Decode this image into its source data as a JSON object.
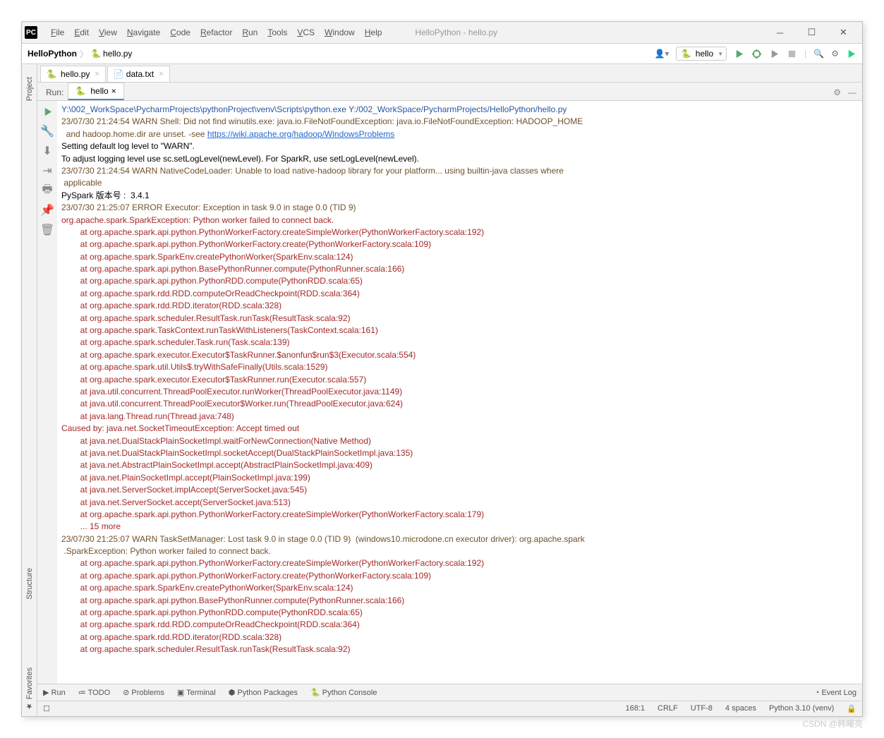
{
  "window": {
    "app_badge": "PC",
    "title": "HelloPython - hello.py"
  },
  "menu": [
    "File",
    "Edit",
    "View",
    "Navigate",
    "Code",
    "Refactor",
    "Run",
    "Tools",
    "VCS",
    "Window",
    "Help"
  ],
  "breadcrumb": {
    "project": "HelloPython",
    "file": "hello.py"
  },
  "run_config": "hello",
  "editor_tabs": [
    {
      "icon": "python",
      "label": "hello.py"
    },
    {
      "icon": "text",
      "label": "data.txt"
    }
  ],
  "run": {
    "label": "Run:",
    "tab": "hello"
  },
  "left_tabs": [
    "Project",
    "Structure",
    "Favorites"
  ],
  "console_lines": [
    {
      "c": "blue",
      "t": "Y:\\002_WorkSpace\\PycharmProjects\\pythonProject\\venv\\Scripts\\python.exe Y:/002_WorkSpace/PycharmProjects/HelloPython/hello.py"
    },
    {
      "c": "brown",
      "t": "23/07/30 21:24:54 WARN Shell: Did not find winutils.exe: java.io.FileNotFoundException: java.io.FileNotFoundException: HADOOP_HOME"
    },
    {
      "c": "brown",
      "t": "  and hadoop.home.dir are unset. -see ",
      "link": "https://wiki.apache.org/hadoop/WindowsProblems"
    },
    {
      "c": "black",
      "t": "Setting default log level to \"WARN\"."
    },
    {
      "c": "black",
      "t": "To adjust logging level use sc.setLogLevel(newLevel). For SparkR, use setLogLevel(newLevel)."
    },
    {
      "c": "brown",
      "t": "23/07/30 21:24:54 WARN NativeCodeLoader: Unable to load native-hadoop library for your platform... using builtin-java classes where"
    },
    {
      "c": "brown",
      "t": " applicable"
    },
    {
      "c": "black",
      "t": "PySpark 版本号 :  3.4.1"
    },
    {
      "c": "brown",
      "t": "23/07/30 21:25:07 ERROR Executor: Exception in task 9.0 in stage 0.0 (TID 9)"
    },
    {
      "c": "red",
      "t": "org.apache.spark.SparkException: Python worker failed to connect back."
    },
    {
      "c": "red",
      "t": "        at org.apache.spark.api.python.PythonWorkerFactory.createSimpleWorker(PythonWorkerFactory.scala:192)"
    },
    {
      "c": "red",
      "t": "        at org.apache.spark.api.python.PythonWorkerFactory.create(PythonWorkerFactory.scala:109)"
    },
    {
      "c": "red",
      "t": "        at org.apache.spark.SparkEnv.createPythonWorker(SparkEnv.scala:124)"
    },
    {
      "c": "red",
      "t": "        at org.apache.spark.api.python.BasePythonRunner.compute(PythonRunner.scala:166)"
    },
    {
      "c": "red",
      "t": "        at org.apache.spark.api.python.PythonRDD.compute(PythonRDD.scala:65)"
    },
    {
      "c": "red",
      "t": "        at org.apache.spark.rdd.RDD.computeOrReadCheckpoint(RDD.scala:364)"
    },
    {
      "c": "red",
      "t": "        at org.apache.spark.rdd.RDD.iterator(RDD.scala:328)"
    },
    {
      "c": "red",
      "t": "        at org.apache.spark.scheduler.ResultTask.runTask(ResultTask.scala:92)"
    },
    {
      "c": "red",
      "t": "        at org.apache.spark.TaskContext.runTaskWithListeners(TaskContext.scala:161)"
    },
    {
      "c": "red",
      "t": "        at org.apache.spark.scheduler.Task.run(Task.scala:139)"
    },
    {
      "c": "red",
      "t": "        at org.apache.spark.executor.Executor$TaskRunner.$anonfun$run$3(Executor.scala:554)"
    },
    {
      "c": "red",
      "t": "        at org.apache.spark.util.Utils$.tryWithSafeFinally(Utils.scala:1529)"
    },
    {
      "c": "red",
      "t": "        at org.apache.spark.executor.Executor$TaskRunner.run(Executor.scala:557)"
    },
    {
      "c": "red",
      "t": "        at java.util.concurrent.ThreadPoolExecutor.runWorker(ThreadPoolExecutor.java:1149)"
    },
    {
      "c": "red",
      "t": "        at java.util.concurrent.ThreadPoolExecutor$Worker.run(ThreadPoolExecutor.java:624)"
    },
    {
      "c": "red",
      "t": "        at java.lang.Thread.run(Thread.java:748)"
    },
    {
      "c": "red",
      "t": "Caused by: java.net.SocketTimeoutException: Accept timed out"
    },
    {
      "c": "red",
      "t": "        at java.net.DualStackPlainSocketImpl.waitForNewConnection(Native Method)"
    },
    {
      "c": "red",
      "t": "        at java.net.DualStackPlainSocketImpl.socketAccept(DualStackPlainSocketImpl.java:135)"
    },
    {
      "c": "red",
      "t": "        at java.net.AbstractPlainSocketImpl.accept(AbstractPlainSocketImpl.java:409)"
    },
    {
      "c": "red",
      "t": "        at java.net.PlainSocketImpl.accept(PlainSocketImpl.java:199)"
    },
    {
      "c": "red",
      "t": "        at java.net.ServerSocket.implAccept(ServerSocket.java:545)"
    },
    {
      "c": "red",
      "t": "        at java.net.ServerSocket.accept(ServerSocket.java:513)"
    },
    {
      "c": "red",
      "t": "        at org.apache.spark.api.python.PythonWorkerFactory.createSimpleWorker(PythonWorkerFactory.scala:179)"
    },
    {
      "c": "red",
      "t": "        ... 15 more"
    },
    {
      "c": "brown",
      "t": "23/07/30 21:25:07 WARN TaskSetManager: Lost task 9.0 in stage 0.0 (TID 9)  (windows10.microdone.cn executor driver): org.apache.spark"
    },
    {
      "c": "brown",
      "t": " .SparkException: Python worker failed to connect back."
    },
    {
      "c": "red",
      "t": "        at org.apache.spark.api.python.PythonWorkerFactory.createSimpleWorker(PythonWorkerFactory.scala:192)"
    },
    {
      "c": "red",
      "t": "        at org.apache.spark.api.python.PythonWorkerFactory.create(PythonWorkerFactory.scala:109)"
    },
    {
      "c": "red",
      "t": "        at org.apache.spark.SparkEnv.createPythonWorker(SparkEnv.scala:124)"
    },
    {
      "c": "red",
      "t": "        at org.apache.spark.api.python.BasePythonRunner.compute(PythonRunner.scala:166)"
    },
    {
      "c": "red",
      "t": "        at org.apache.spark.api.python.PythonRDD.compute(PythonRDD.scala:65)"
    },
    {
      "c": "red",
      "t": "        at org.apache.spark.rdd.RDD.computeOrReadCheckpoint(RDD.scala:364)"
    },
    {
      "c": "red",
      "t": "        at org.apache.spark.rdd.RDD.iterator(RDD.scala:328)"
    },
    {
      "c": "red",
      "t": "        at org.apache.spark.scheduler.ResultTask.runTask(ResultTask.scala:92)"
    }
  ],
  "bottom_tools": [
    "Run",
    "TODO",
    "Problems",
    "Terminal",
    "Python Packages",
    "Python Console"
  ],
  "event_log": "Event Log",
  "status": {
    "pos": "168:1",
    "sep": "CRLF",
    "enc": "UTF-8",
    "indent": "4 spaces",
    "interp": "Python 3.10 (venv)"
  },
  "watermark": "CSDN @韩曙亮"
}
